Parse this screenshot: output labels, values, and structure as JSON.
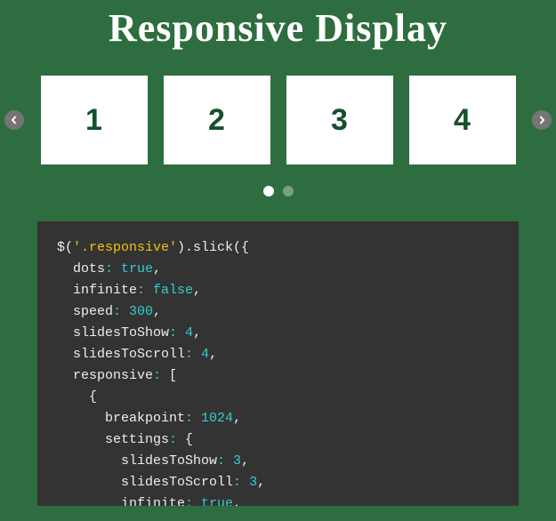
{
  "title": "Responsive Display",
  "slides": [
    "1",
    "2",
    "3",
    "4"
  ],
  "dots": {
    "total": 2,
    "active": 0
  },
  "code": {
    "lines": [
      [
        {
          "t": "$(",
          "c": "p"
        },
        {
          "t": "'.responsive'",
          "c": "sel"
        },
        {
          "t": ").slick({",
          "c": "p"
        }
      ],
      [
        {
          "t": "  dots",
          "c": "k"
        },
        {
          "t": ": ",
          "c": "c"
        },
        {
          "t": "true",
          "c": "b"
        },
        {
          "t": ",",
          "c": "p"
        }
      ],
      [
        {
          "t": "  infinite",
          "c": "k"
        },
        {
          "t": ": ",
          "c": "c"
        },
        {
          "t": "false",
          "c": "b"
        },
        {
          "t": ",",
          "c": "p"
        }
      ],
      [
        {
          "t": "  speed",
          "c": "k"
        },
        {
          "t": ": ",
          "c": "c"
        },
        {
          "t": "300",
          "c": "n"
        },
        {
          "t": ",",
          "c": "p"
        }
      ],
      [
        {
          "t": "  slidesToShow",
          "c": "k"
        },
        {
          "t": ": ",
          "c": "c"
        },
        {
          "t": "4",
          "c": "n"
        },
        {
          "t": ",",
          "c": "p"
        }
      ],
      [
        {
          "t": "  slidesToScroll",
          "c": "k"
        },
        {
          "t": ": ",
          "c": "c"
        },
        {
          "t": "4",
          "c": "n"
        },
        {
          "t": ",",
          "c": "p"
        }
      ],
      [
        {
          "t": "  responsive",
          "c": "k"
        },
        {
          "t": ": ",
          "c": "c"
        },
        {
          "t": "[",
          "c": "p"
        }
      ],
      [
        {
          "t": "    {",
          "c": "p"
        }
      ],
      [
        {
          "t": "      breakpoint",
          "c": "k"
        },
        {
          "t": ": ",
          "c": "c"
        },
        {
          "t": "1024",
          "c": "n"
        },
        {
          "t": ",",
          "c": "p"
        }
      ],
      [
        {
          "t": "      settings",
          "c": "k"
        },
        {
          "t": ": ",
          "c": "c"
        },
        {
          "t": "{",
          "c": "p"
        }
      ],
      [
        {
          "t": "        slidesToShow",
          "c": "k"
        },
        {
          "t": ": ",
          "c": "c"
        },
        {
          "t": "3",
          "c": "n"
        },
        {
          "t": ",",
          "c": "p"
        }
      ],
      [
        {
          "t": "        slidesToScroll",
          "c": "k"
        },
        {
          "t": ": ",
          "c": "c"
        },
        {
          "t": "3",
          "c": "n"
        },
        {
          "t": ",",
          "c": "p"
        }
      ],
      [
        {
          "t": "        infinite",
          "c": "k"
        },
        {
          "t": ": ",
          "c": "c"
        },
        {
          "t": "true",
          "c": "b"
        },
        {
          "t": ",",
          "c": "p"
        }
      ]
    ]
  }
}
